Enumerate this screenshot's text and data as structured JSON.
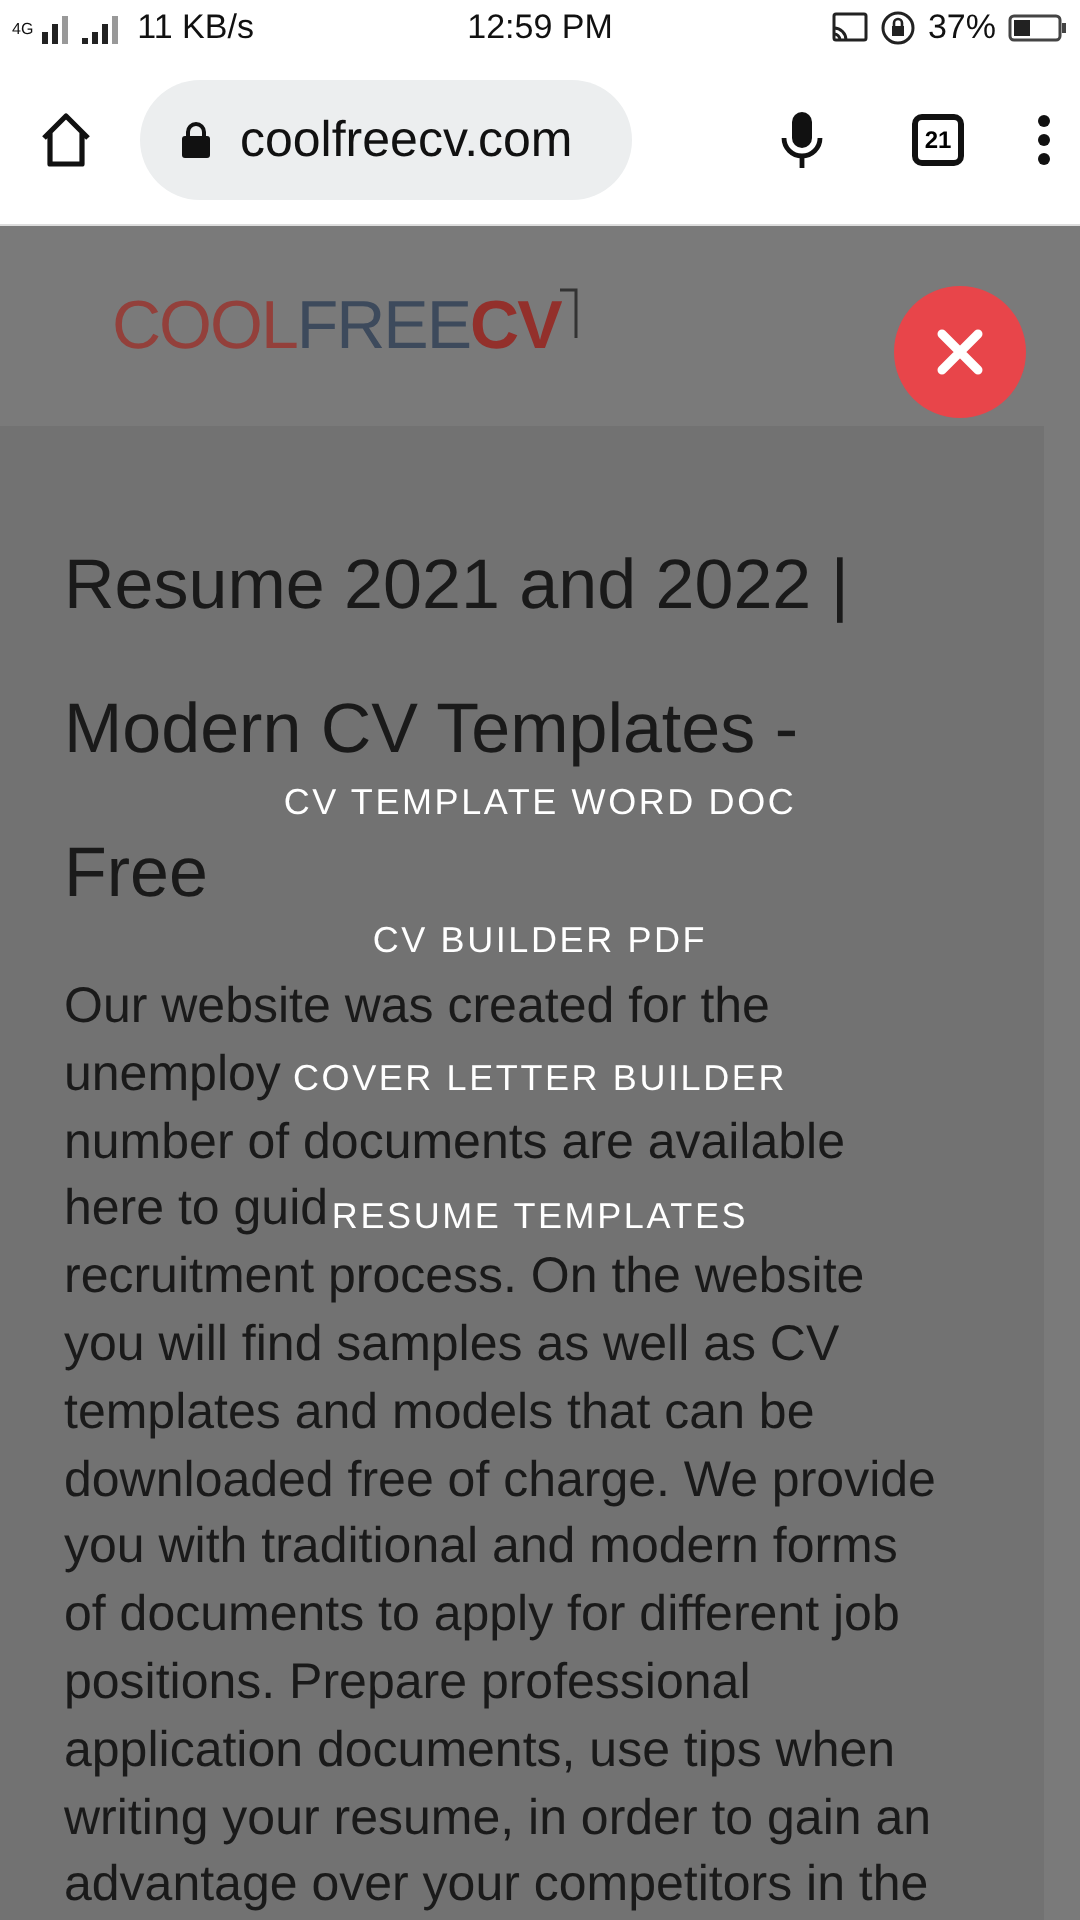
{
  "status_bar": {
    "network": "4G",
    "speed": "11 KB/s",
    "time": "12:59 PM",
    "battery": "37%"
  },
  "browser": {
    "url": "coolfreecv.com",
    "tabs_count": "21"
  },
  "logo": {
    "parts": [
      "COOL",
      "FREE",
      "CV"
    ]
  },
  "heading_lines": [
    "Resume 2021 and 2022 |",
    "Modern CV Templates -",
    "Free"
  ],
  "body_lines": [
    "Our website was created for the",
    "unemploy",
    "number of documents are available",
    "here to guid",
    "recruitment process. On the website",
    "you will find samples as well as CV",
    "templates and models that can be",
    "downloaded free of charge. We provide",
    "you with traditional and modern forms",
    "of documents to apply for different job",
    "positions. Prepare professional",
    "application documents, use tips when",
    "writing your resume, in order to gain an",
    "advantage over your competitors in the"
  ],
  "menu": [
    "CV TEMPLATE WORD DOC",
    "CV BUILDER PDF",
    "COVER LETTER BUILDER",
    "RESUME TEMPLATES"
  ]
}
